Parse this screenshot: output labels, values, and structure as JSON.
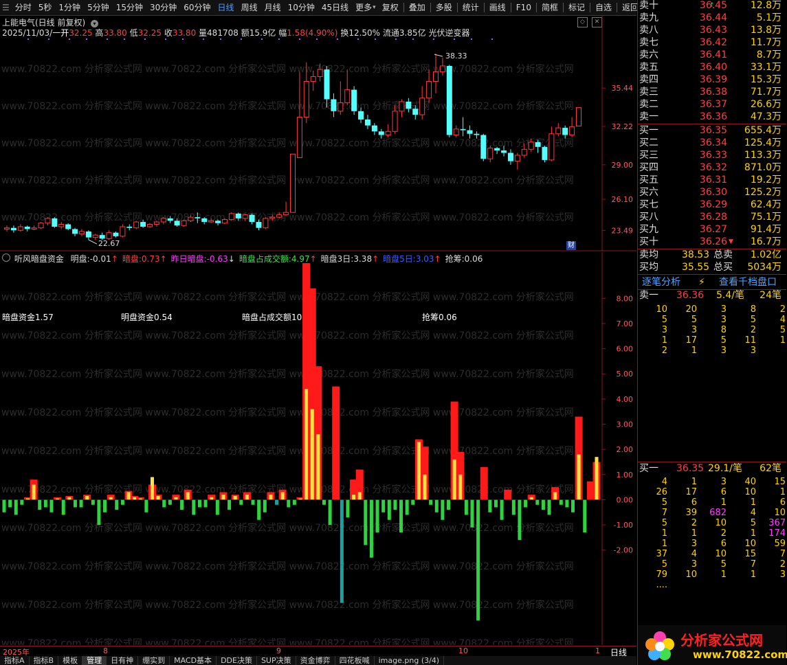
{
  "toolbar": {
    "left_items": [
      "分时",
      "5秒",
      "1分钟",
      "5分钟",
      "15分钟",
      "30分钟",
      "60分钟",
      "日线",
      "周线",
      "月线",
      "10分钟",
      "45日线",
      "更多"
    ],
    "active": "日线",
    "right_items": [
      "复权",
      "叠加",
      "多股",
      "统计",
      "画线",
      "F10",
      "简框",
      "标记",
      "自选",
      "返回"
    ]
  },
  "stock": {
    "title": "上能电气(日线 前复权)",
    "date": "2025/11/03/一",
    "open_label": "开",
    "open": "32.25",
    "high_label": "高",
    "high": "33.80",
    "low_label": "低",
    "low": "32.25",
    "close_label": "收",
    "close": "33.80",
    "vol_label": "量",
    "vol": "481708",
    "amount_label": "额",
    "amount": "15.9亿",
    "change_label": "幅",
    "change": "1.58(4.90%)",
    "turnover": "换12.50%",
    "float": "流通3.85亿",
    "concept": "光伏逆变器",
    "max_label": "38.33",
    "min_label": "22.67",
    "cai_badge": "财"
  },
  "price_axis": {
    "ticks": [
      "35.44",
      "32.22",
      "29.00",
      "26.10",
      "23.49"
    ]
  },
  "indicator": {
    "name": "听风暗盘资金",
    "items": [
      {
        "label": "明盘:",
        "value": "-0.01",
        "arrow": "↑",
        "color": "#dddddd"
      },
      {
        "label": "暗盘:",
        "value": "0.73",
        "arrow": "↑",
        "color": "#ff4040"
      },
      {
        "label": "昨日暗盘:",
        "value": "-0.63",
        "arrow": "↓",
        "color": "#ff3fff"
      },
      {
        "label": "暗盘占成交额:",
        "value": "4.97",
        "arrow": "↑",
        "color": "#3fe04f"
      },
      {
        "label": "暗盘3日:",
        "value": "3.38",
        "arrow": "↑",
        "color": "#dddddd"
      },
      {
        "label": "暗盘5日:",
        "value": "3.03",
        "arrow": "↑",
        "color": "#3f5bff"
      },
      {
        "label": "抢筹:",
        "value": "0.06",
        "arrow": "",
        "color": "#dddddd"
      }
    ],
    "stats": [
      {
        "text": "暗盘资金1.57"
      },
      {
        "text": "明盘资金0.54"
      },
      {
        "text": "暗盘占成交额10.36"
      },
      {
        "text": "抢筹0.06"
      }
    ]
  },
  "ind_axis": {
    "ticks": [
      "8.00",
      "7.00",
      "6.00",
      "5.00",
      "4.00",
      "3.00",
      "2.00",
      "1.00",
      "0.00",
      "-1.00",
      "-2.00"
    ]
  },
  "date_axis": {
    "labels": [
      "2025年",
      "8",
      "9",
      "10",
      "1"
    ]
  },
  "period_label": "日线",
  "bottom_tabs": [
    "指标A",
    "指标B",
    "模板",
    "管理",
    "日有神",
    "绷实到",
    "MACD基本",
    "DDE决策",
    "SUP决策",
    "资金博弈",
    "四花板喊",
    "image.png (3/4)"
  ],
  "orderbook": {
    "sells": [
      {
        "label": "卖十",
        "price": "36.45",
        "vol": "12.8万"
      },
      {
        "label": "卖九",
        "price": "36.44",
        "vol": "5.1万"
      },
      {
        "label": "卖八",
        "price": "36.43",
        "vol": "13.8万"
      },
      {
        "label": "卖七",
        "price": "36.42",
        "vol": "11.7万"
      },
      {
        "label": "卖六",
        "price": "36.41",
        "vol": "8.7万"
      },
      {
        "label": "卖五",
        "price": "36.40",
        "vol": "33.1万"
      },
      {
        "label": "卖四",
        "price": "36.39",
        "vol": "15.3万"
      },
      {
        "label": "卖三",
        "price": "36.38",
        "vol": "71.7万"
      },
      {
        "label": "卖二",
        "price": "36.37",
        "vol": "26.6万"
      },
      {
        "label": "卖一",
        "price": "36.36",
        "vol": "47.3万"
      }
    ],
    "buys": [
      {
        "label": "买一",
        "price": "36.35",
        "vol": "655.4万"
      },
      {
        "label": "买二",
        "price": "36.34",
        "vol": "125.4万"
      },
      {
        "label": "买三",
        "price": "36.33",
        "vol": "113.3万"
      },
      {
        "label": "买四",
        "price": "36.32",
        "vol": "871.0万"
      },
      {
        "label": "买五",
        "price": "36.31",
        "vol": "19.2万"
      },
      {
        "label": "买六",
        "price": "36.30",
        "vol": "125.2万"
      },
      {
        "label": "买七",
        "price": "36.29",
        "vol": "62.4万"
      },
      {
        "label": "买八",
        "price": "36.28",
        "vol": "75.1万"
      },
      {
        "label": "买九",
        "price": "36.27",
        "vol": "91.4万"
      },
      {
        "label": "买十",
        "price": "36.26",
        "vol": "16.7万"
      }
    ],
    "avg_sell_label": "卖均",
    "avg_sell": "38.53",
    "total_sell_label": "总卖",
    "total_sell": "1.02亿",
    "avg_buy_label": "买均",
    "avg_buy": "35.55",
    "total_buy_label": "总买",
    "total_buy": "5034万"
  },
  "ticks": {
    "tab_left": "逐笔分析",
    "tab_right": "查看千档盘口",
    "sell_head": {
      "label": "卖一",
      "price": "36.36",
      "per": "5.4/笔",
      "count": "24笔"
    },
    "sell_rows": [
      [
        "10",
        "20",
        "3",
        "8",
        "2"
      ],
      [
        "5",
        "5",
        "3",
        "5",
        "4"
      ],
      [
        "3",
        "3",
        "8",
        "2",
        "5"
      ],
      [
        "1",
        "17",
        "5",
        "11",
        "1"
      ],
      [
        "2",
        "1",
        "3",
        "3",
        ""
      ]
    ],
    "buy_head": {
      "label": "买一",
      "price": "36.35",
      "per": "29.1/笔",
      "count": "62笔"
    },
    "buy_rows": [
      [
        "4",
        "1",
        "3",
        "40",
        "15"
      ],
      [
        "26",
        "17",
        "6",
        "10",
        "1"
      ],
      [
        "5",
        "6",
        "1",
        "1",
        "6"
      ],
      [
        "7",
        "39",
        "682",
        "4",
        "10"
      ],
      [
        "5",
        "2",
        "10",
        "5",
        "367"
      ],
      [
        "1",
        "1",
        "2",
        "1",
        "174"
      ],
      [
        "1",
        "3",
        "6",
        "10",
        "59"
      ],
      [
        "37",
        "4",
        "10",
        "15",
        "7"
      ],
      [
        "5",
        "3",
        "5",
        "7",
        "2"
      ],
      [
        "79",
        "10",
        "1",
        "1",
        "3"
      ],
      [
        "....",
        "",
        "",
        "",
        ""
      ]
    ]
  },
  "logo": {
    "text": "分析家公式网",
    "url": "www.70822.com"
  },
  "watermark": "www.70822.com 分析家公式网",
  "chart_data": {
    "type": "candlestick+bar",
    "candles": [
      [
        23.6,
        23.7,
        23.4,
        23.9
      ],
      [
        23.7,
        23.5,
        23.3,
        23.9
      ],
      [
        23.5,
        23.8,
        23.4,
        24.0
      ],
      [
        23.8,
        23.6,
        23.4,
        23.9
      ],
      [
        23.6,
        23.7,
        23.5,
        23.9
      ],
      [
        23.7,
        24.1,
        23.6,
        24.2
      ],
      [
        24.1,
        24.5,
        23.9,
        24.6
      ],
      [
        24.5,
        23.8,
        23.7,
        24.6
      ],
      [
        23.8,
        24.0,
        23.6,
        24.2
      ],
      [
        24.0,
        23.6,
        23.5,
        24.1
      ],
      [
        23.6,
        23.2,
        23.0,
        23.7
      ],
      [
        23.2,
        23.4,
        23.0,
        23.6
      ],
      [
        23.4,
        22.9,
        22.7,
        23.5
      ],
      [
        22.9,
        23.1,
        22.7,
        23.2
      ],
      [
        23.1,
        22.8,
        22.7,
        23.3
      ],
      [
        22.8,
        23.3,
        22.7,
        23.5
      ],
      [
        23.3,
        23.0,
        22.9,
        23.4
      ],
      [
        23.0,
        23.8,
        22.9,
        24.0
      ],
      [
        23.8,
        23.7,
        23.5,
        24.0
      ],
      [
        23.7,
        24.2,
        23.6,
        24.3
      ],
      [
        24.2,
        23.8,
        23.7,
        24.4
      ],
      [
        23.8,
        24.0,
        23.7,
        24.1
      ],
      [
        24.0,
        24.2,
        23.8,
        24.3
      ],
      [
        24.2,
        24.5,
        24.0,
        24.6
      ],
      [
        24.5,
        24.3,
        24.1,
        24.7
      ],
      [
        24.3,
        23.9,
        23.8,
        24.5
      ],
      [
        23.9,
        24.3,
        23.8,
        24.4
      ],
      [
        24.3,
        24.6,
        24.2,
        24.8
      ],
      [
        24.6,
        24.5,
        24.1,
        25.0
      ],
      [
        24.5,
        24.2,
        24.0,
        24.6
      ],
      [
        24.2,
        24.3,
        24.1,
        24.5
      ],
      [
        24.3,
        24.1,
        23.9,
        24.4
      ],
      [
        24.1,
        24.4,
        24.0,
        24.5
      ],
      [
        24.4,
        24.9,
        24.3,
        25.0
      ],
      [
        24.9,
        24.5,
        24.3,
        25.0
      ],
      [
        24.5,
        24.8,
        24.3,
        24.9
      ],
      [
        24.8,
        24.2,
        24.0,
        24.9
      ],
      [
        24.2,
        23.7,
        23.5,
        24.4
      ],
      [
        23.7,
        24.5,
        23.6,
        24.6
      ],
      [
        24.5,
        24.6,
        24.3,
        24.8
      ],
      [
        24.6,
        24.8,
        24.5,
        25.0
      ],
      [
        24.8,
        25.0,
        24.7,
        25.9
      ],
      [
        25.0,
        29.9,
        25.0,
        29.9
      ],
      [
        29.6,
        33.0,
        29.6,
        36.8
      ],
      [
        33.0,
        36.0,
        32.5,
        37.6
      ],
      [
        36.0,
        36.4,
        35.2,
        36.9
      ],
      [
        36.4,
        37.0,
        36.0,
        37.5
      ],
      [
        37.0,
        34.5,
        33.8,
        37.3
      ],
      [
        34.5,
        33.5,
        33.0,
        35.0
      ],
      [
        33.5,
        34.2,
        33.2,
        36.0
      ],
      [
        34.2,
        35.3,
        34.0,
        37.0
      ],
      [
        35.3,
        33.5,
        33.2,
        35.6
      ],
      [
        33.5,
        32.8,
        32.5,
        33.8
      ],
      [
        32.8,
        32.3,
        32.0,
        33.2
      ],
      [
        32.3,
        31.8,
        31.5,
        32.5
      ],
      [
        31.8,
        31.5,
        31.2,
        32.0
      ],
      [
        31.5,
        31.8,
        31.3,
        32.4
      ],
      [
        31.8,
        33.5,
        31.6,
        34.0
      ],
      [
        33.5,
        34.3,
        33.0,
        34.5
      ],
      [
        34.3,
        33.7,
        33.4,
        34.6
      ],
      [
        33.7,
        33.2,
        32.8,
        34.0
      ],
      [
        33.2,
        34.6,
        32.8,
        35.6
      ],
      [
        34.6,
        36.0,
        34.2,
        37.0
      ],
      [
        36.0,
        36.8,
        35.0,
        38.33
      ],
      [
        36.8,
        37.3,
        36.5,
        38.0
      ],
      [
        37.3,
        31.5,
        31.3,
        37.4
      ],
      [
        31.5,
        32.0,
        31.3,
        32.3
      ],
      [
        32.0,
        31.9,
        31.4,
        33.0
      ],
      [
        31.9,
        31.6,
        31.2,
        32.3
      ],
      [
        31.6,
        31.5,
        31.2,
        31.8
      ],
      [
        31.5,
        29.5,
        29.3,
        31.6
      ],
      [
        29.5,
        30.4,
        29.2,
        30.6
      ],
      [
        30.4,
        30.2,
        29.9,
        30.5
      ],
      [
        30.2,
        30.0,
        29.7,
        30.6
      ],
      [
        30.0,
        29.3,
        29.0,
        30.3
      ],
      [
        29.3,
        29.8,
        28.6,
        30.0
      ],
      [
        29.8,
        30.3,
        29.6,
        30.8
      ],
      [
        30.3,
        30.9,
        30.1,
        31.2
      ],
      [
        30.9,
        30.5,
        30.0,
        31.1
      ],
      [
        30.5,
        29.4,
        29.2,
        30.6
      ],
      [
        29.4,
        31.6,
        29.3,
        32.2
      ],
      [
        31.6,
        32.1,
        31.4,
        32.5
      ],
      [
        32.1,
        31.5,
        31.2,
        32.3
      ],
      [
        31.5,
        32.2,
        31.3,
        33.0
      ],
      [
        32.25,
        33.8,
        32.25,
        33.8
      ]
    ],
    "indicator_bars": [
      {
        "v": -0.5,
        "inner": -0.3
      },
      {
        "v": -0.3,
        "inner": -0.2
      },
      {
        "v": -0.6,
        "inner": -0.4
      },
      {
        "v": -0.2,
        "inner": 0
      },
      {
        "v": 0.1,
        "inner": 0.05
      },
      {
        "v": 0.8,
        "inner": 0.6
      },
      {
        "v": -0.4,
        "inner": -0.3
      },
      {
        "v": -0.3,
        "inner": -0.3
      },
      {
        "v": -0.5,
        "inner": -0.3
      },
      {
        "v": 0.1,
        "inner": 0.05
      },
      {
        "v": -0.6,
        "inner": -0.4
      },
      {
        "v": 0.15,
        "inner": 0.1
      },
      {
        "v": -0.3,
        "inner": -0.2
      },
      {
        "v": -0.3,
        "inner": -0.2
      },
      {
        "v": 0.2,
        "inner": 0.15
      },
      {
        "v": -0.2,
        "inner": -0.1
      },
      {
        "v": -1.0,
        "inner": -0.6
      },
      {
        "v": -0.5,
        "inner": -0.3
      },
      {
        "v": 0.2,
        "inner": 0.1
      },
      {
        "v": -0.4,
        "inner": -0.3
      },
      {
        "v": -0.2,
        "inner": -0.1
      },
      {
        "v": 0.35,
        "inner": 0.3
      },
      {
        "v": 0.15,
        "inner": 0.1
      },
      {
        "v": 0.1,
        "inner": 0.05
      },
      {
        "v": -0.5,
        "inner": -0.3
      },
      {
        "v": 0.6,
        "inner": 0.9
      },
      {
        "v": 0.2,
        "inner": 0.15
      },
      {
        "v": -0.3,
        "inner": -0.2
      },
      {
        "v": -0.2,
        "inner": -0.1
      },
      {
        "v": 0.2,
        "inner": 0.1
      },
      {
        "v": -0.4,
        "inner": -0.3
      },
      {
        "v": 0.4,
        "inner": 0.3
      },
      {
        "v": -0.6,
        "inner": -0.4
      },
      {
        "v": -0.3,
        "inner": -0.2
      },
      {
        "v": -0.3,
        "inner": -0.2
      },
      {
        "v": 0.2,
        "inner": 0.1
      },
      {
        "v": -0.6,
        "inner": -0.4
      },
      {
        "v": 0.3,
        "inner": 0.2
      },
      {
        "v": -0.4,
        "inner": -0.3
      },
      {
        "v": 0.2,
        "inner": 0.15
      },
      {
        "v": -0.2,
        "inner": -0.2
      },
      {
        "v": 0.3,
        "inner": 0.2
      },
      {
        "v": -0.2,
        "inner": -0.15
      },
      {
        "v": -0.8,
        "inner": -0.6
      },
      {
        "v": -0.5,
        "inner": -0.3
      },
      {
        "v": 0.3,
        "inner": 0.2
      },
      {
        "v": -0.2,
        "inner": -0.1
      },
      {
        "v": 0.4,
        "inner": 0.3
      },
      {
        "v": -0.3,
        "inner": -0.2
      },
      {
        "v": -0.2,
        "inner": -0.1
      },
      {
        "v": 0.1,
        "inner": 0.05
      },
      {
        "v": 9.4,
        "inner": 4.4
      },
      {
        "v": 8.4,
        "inner": 3.6
      },
      {
        "v": 5.3,
        "inner": 2.6
      },
      {
        "v": -0.2,
        "inner": -0.1
      },
      {
        "v": -1.0,
        "inner": -0.6
      },
      {
        "v": 4.5,
        "inner": 0.0
      },
      {
        "v": -2.6,
        "inner": -4.1
      },
      {
        "v": -0.7,
        "inner": -0.4
      },
      {
        "v": 0.8,
        "inner": 0.2
      },
      {
        "v": 1.2,
        "inner": 0.3
      },
      {
        "v": -1.8,
        "inner": -1.0
      },
      {
        "v": -2.3,
        "inner": -1.4
      },
      {
        "v": -1.3,
        "inner": -0.7
      },
      {
        "v": -0.5,
        "inner": -0.3
      },
      {
        "v": -0.8,
        "inner": -0.6
      },
      {
        "v": -0.4,
        "inner": -0.3
      },
      {
        "v": -1.3,
        "inner": -0.6
      },
      {
        "v": -0.6,
        "inner": -0.4
      },
      {
        "v": -0.2,
        "inner": -0.1
      },
      {
        "v": 2.4,
        "inner": 2.3
      },
      {
        "v": 2.1,
        "inner": 1.0
      },
      {
        "v": -0.2,
        "inner": -0.1
      },
      {
        "v": -0.5,
        "inner": -0.3
      },
      {
        "v": -0.8,
        "inner": -0.5
      },
      {
        "v": -0.4,
        "inner": -0.2
      },
      {
        "v": 3.9,
        "inner": 1.6
      },
      {
        "v": 1.9,
        "inner": 1.0
      },
      {
        "v": -0.6,
        "inner": -0.3
      },
      {
        "v": -1.1,
        "inner": -0.7
      },
      {
        "v": -4.8,
        "inner": -4.7
      },
      {
        "v": 1.3,
        "inner": 0.0
      },
      {
        "v": -0.5,
        "inner": -0.3
      },
      {
        "v": -0.3,
        "inner": -0.2
      },
      {
        "v": -0.8,
        "inner": -0.5
      },
      {
        "v": 0.4,
        "inner": 0.0
      },
      {
        "v": -0.6,
        "inner": -0.4
      },
      {
        "v": -1.6,
        "inner": -1.4
      },
      {
        "v": -0.3,
        "inner": -0.2
      },
      {
        "v": 0.2,
        "inner": 0.1
      },
      {
        "v": -0.2,
        "inner": -0.1
      },
      {
        "v": -0.4,
        "inner": -0.2
      },
      {
        "v": -0.6,
        "inner": -0.3
      },
      {
        "v": 0.5,
        "inner": 0.3
      },
      {
        "v": -0.2,
        "inner": -0.1
      },
      {
        "v": -0.3,
        "inner": -0.2
      },
      {
        "v": -0.5,
        "inner": -0.3
      },
      {
        "v": 3.3,
        "inner": 1.8
      },
      {
        "v": -1.3,
        "inner": -0.7
      },
      {
        "v": 0.73,
        "inner": 0.0
      },
      {
        "v": 1.5,
        "inner": 1.7
      }
    ],
    "price_range": [
      22.3,
      39.2
    ],
    "indicator_range": [
      -4.9,
      9.4
    ]
  }
}
